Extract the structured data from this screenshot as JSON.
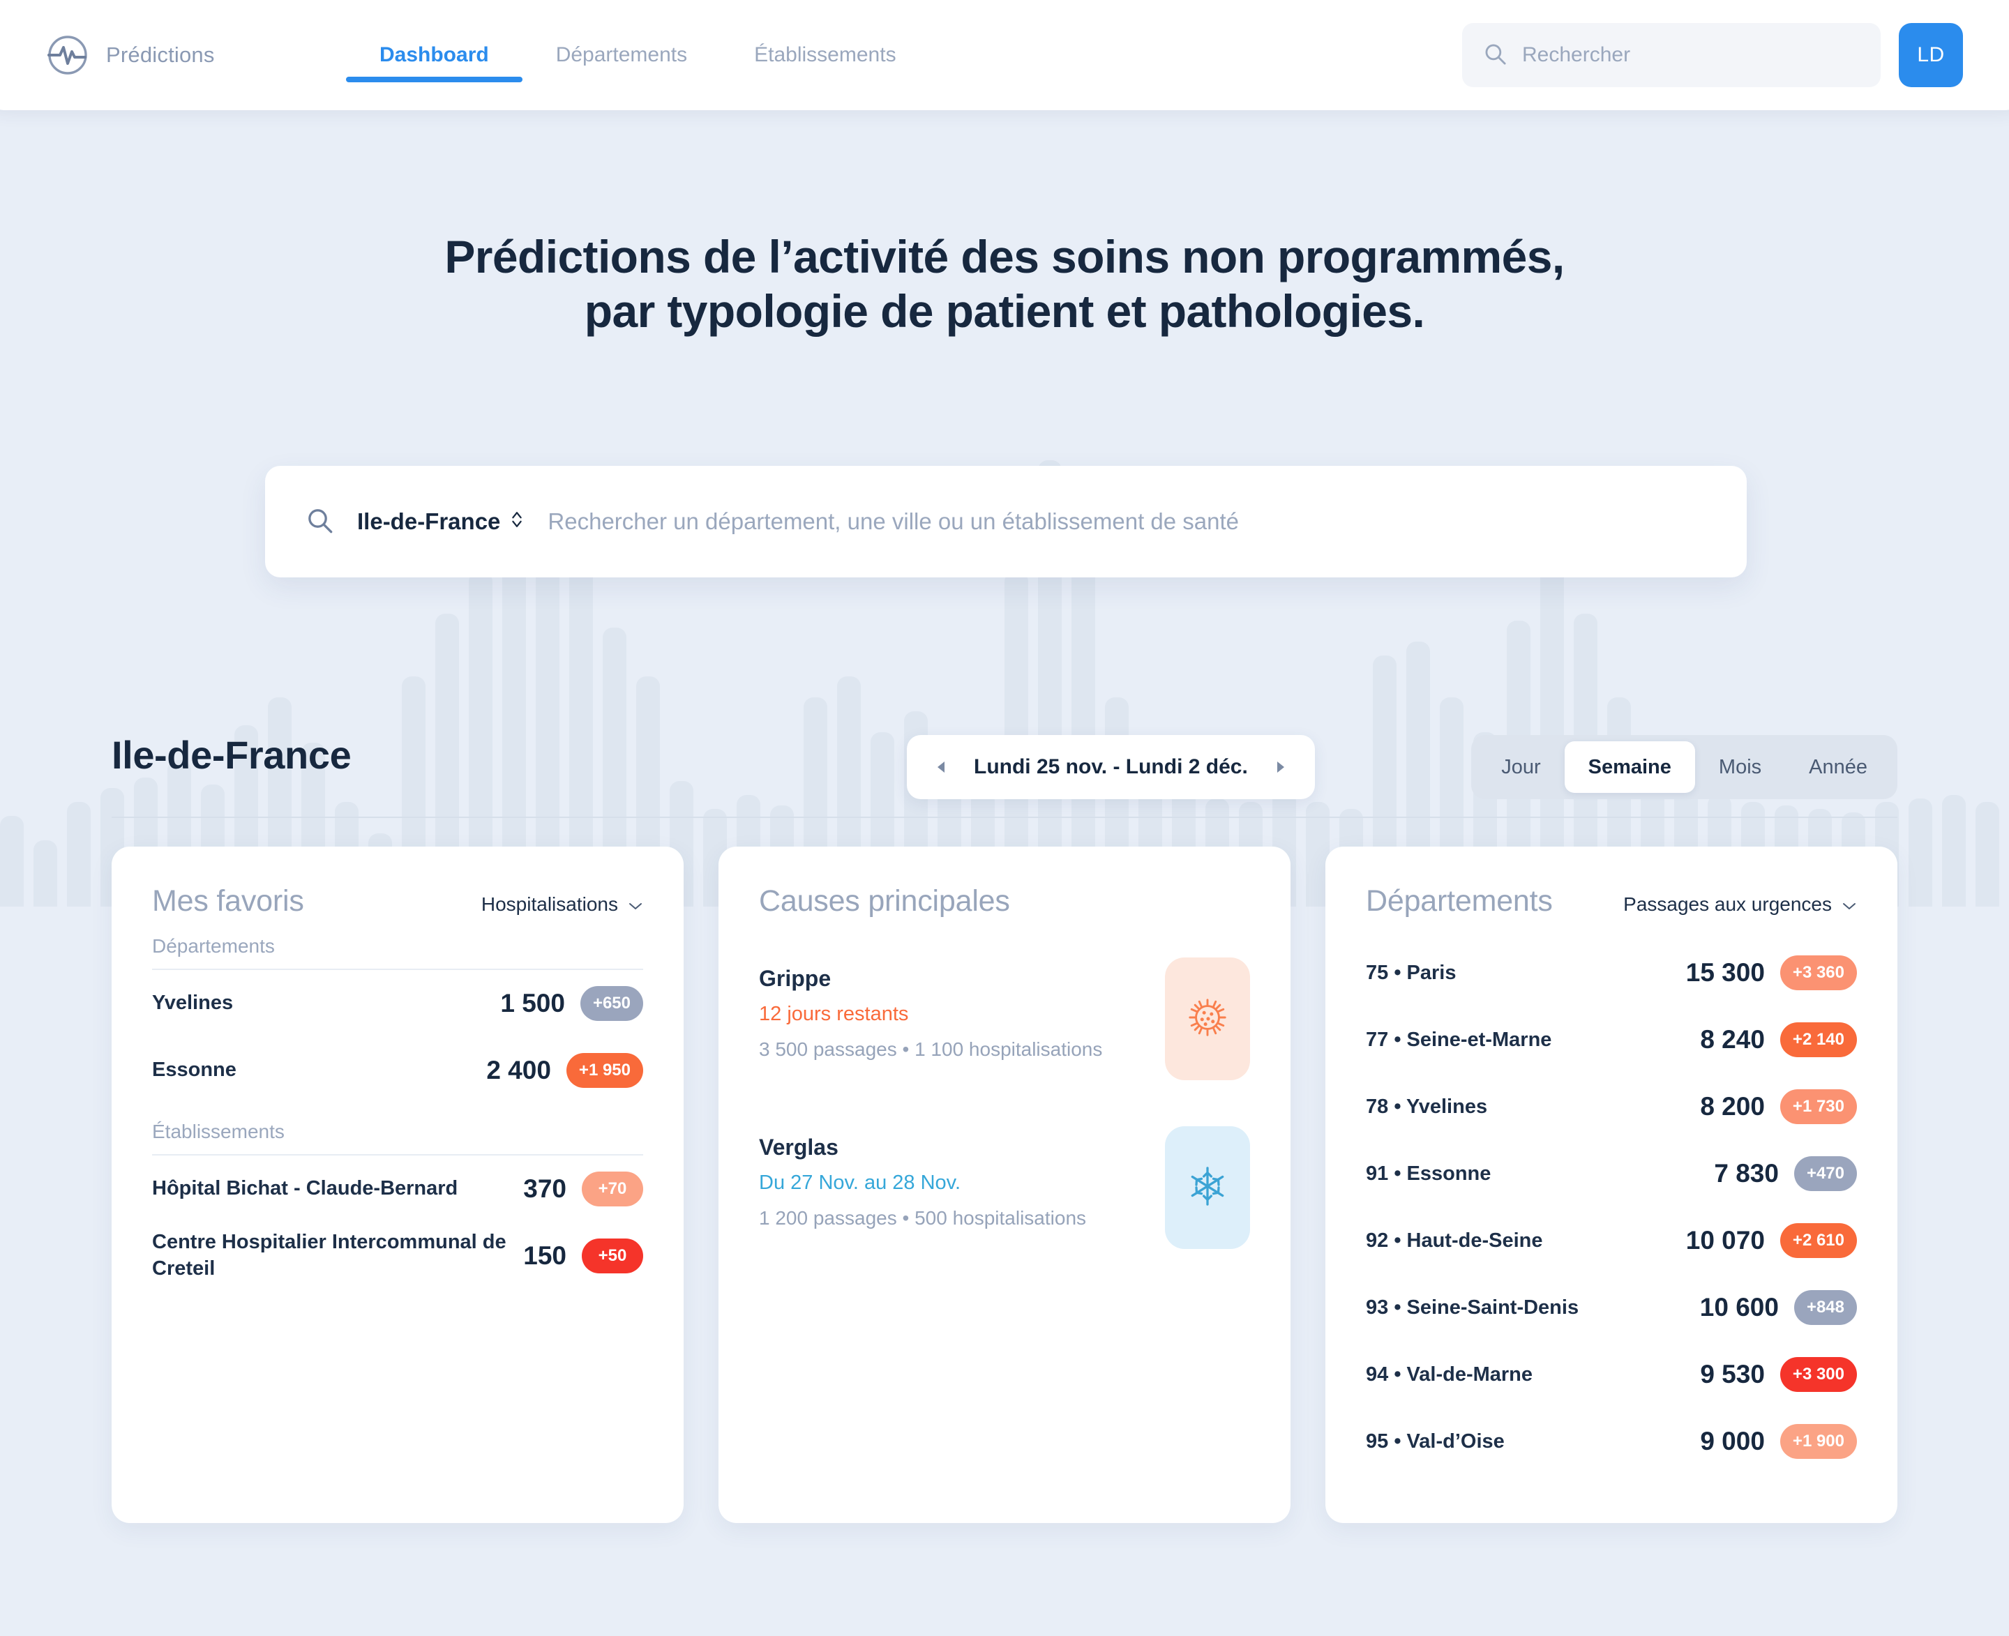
{
  "brand": {
    "name": "Prédictions",
    "logo_icon": "pulse-circle-icon"
  },
  "nav": {
    "tabs": [
      {
        "label": "Dashboard",
        "active": true
      },
      {
        "label": "Départements",
        "active": false
      },
      {
        "label": "Établissements",
        "active": false
      }
    ],
    "search": {
      "placeholder": "Rechercher",
      "value": "",
      "icon": "search-icon"
    },
    "avatar": {
      "initials": "LD",
      "color": "#2b8ced"
    }
  },
  "hero": {
    "title_line1": "Prédictions de l’activité des soins non programmés,",
    "title_line2": "par typologie de patient et pathologies.",
    "search": {
      "icon": "search-icon",
      "region": "Ile-de-France",
      "region_caret_icon": "chevron-updown-icon",
      "placeholder": "Rechercher un département, une ville ou un établissement de santé",
      "value": ""
    }
  },
  "section": {
    "title": "Ile-de-France",
    "date_range": {
      "label": "Lundi 25 nov.  -  Lundi 2 déc.",
      "prev_icon": "chevron-left-icon",
      "next_icon": "chevron-right-icon"
    },
    "periods": [
      {
        "label": "Jour",
        "active": false
      },
      {
        "label": "Semaine",
        "active": true
      },
      {
        "label": "Mois",
        "active": false
      },
      {
        "label": "Année",
        "active": false
      }
    ]
  },
  "favoris": {
    "title": "Mes favoris",
    "metric": "Hospitalisations",
    "metric_caret_icon": "chevron-down-icon",
    "groups": [
      {
        "label": "Départements",
        "rows": [
          {
            "name": "Yvelines",
            "value": "1 500",
            "delta": "+650",
            "delta_color": "#9aa5bd"
          },
          {
            "name": "Essonne",
            "value": "2 400",
            "delta": "+1 950",
            "delta_color": "#f96a3a"
          }
        ]
      },
      {
        "label": "Établissements",
        "rows": [
          {
            "name": "Hôpital Bichat - Claude-Bernard",
            "value": "370",
            "delta": "+70",
            "delta_color": "#fba385"
          },
          {
            "name": "Centre Hospitalier Intercommunal de Creteil",
            "value": "150",
            "delta": "+50",
            "delta_color": "#f5342a"
          }
        ]
      }
    ]
  },
  "causes": {
    "title": "Causes principales",
    "items": [
      {
        "name": "Grippe",
        "sub": "12 jours restants",
        "sub_color": "#f96a3a",
        "stats": "3 500 passages • 1 100 hospitalisations",
        "icon": "virus-icon",
        "icon_bg": "#fde7dd",
        "icon_color": "#f97f4d"
      },
      {
        "name": "Verglas",
        "sub": "Du 27 Nov. au 28 Nov.",
        "sub_color": "#35a7d9",
        "stats": "1 200 passages • 500 hospitalisations",
        "icon": "snowflake-icon",
        "icon_bg": "#ddeffa",
        "icon_color": "#3ba3d4"
      }
    ]
  },
  "departements": {
    "title": "Départements",
    "metric": "Passages aux urgences",
    "metric_caret_icon": "chevron-down-icon",
    "rows": [
      {
        "name": "75 • Paris",
        "value": "15 300",
        "delta": "+3 360",
        "delta_color": "#fb9272"
      },
      {
        "name": "77 • Seine-et-Marne",
        "value": "8 240",
        "delta": "+2 140",
        "delta_color": "#f96a3a"
      },
      {
        "name": "78 • Yvelines",
        "value": "8 200",
        "delta": "+1 730",
        "delta_color": "#fb9272"
      },
      {
        "name": "91 • Essonne",
        "value": "7 830",
        "delta": "+470",
        "delta_color": "#9aa5bd"
      },
      {
        "name": "92 • Haut-de-Seine",
        "value": "10 070",
        "delta": "+2 610",
        "delta_color": "#f96a3a"
      },
      {
        "name": "93 • Seine-Saint-Denis",
        "value": "10 600",
        "delta": "+848",
        "delta_color": "#9aa5bd"
      },
      {
        "name": "94 • Val-de-Marne",
        "value": "9 530",
        "delta": "+3 300",
        "delta_color": "#f5342a"
      },
      {
        "name": "95 • Val-d’Oise",
        "value": "9 000",
        "delta": "+1 900",
        "delta_color": "#fba385"
      }
    ]
  },
  "background": {
    "bar_color": "#dbe3ee",
    "bar_heights": [
      130,
      95,
      150,
      170,
      185,
      210,
      175,
      260,
      300,
      235,
      150,
      105,
      330,
      420,
      480,
      560,
      600,
      520,
      400,
      330,
      180,
      140,
      160,
      145,
      300,
      330,
      250,
      280,
      200,
      165,
      480,
      640,
      560,
      300,
      185,
      170,
      155,
      150,
      165,
      150,
      140,
      360,
      380,
      300,
      250,
      410,
      520,
      420,
      300,
      200,
      170,
      160,
      150,
      145,
      140,
      135,
      150,
      155,
      160,
      150
    ]
  }
}
